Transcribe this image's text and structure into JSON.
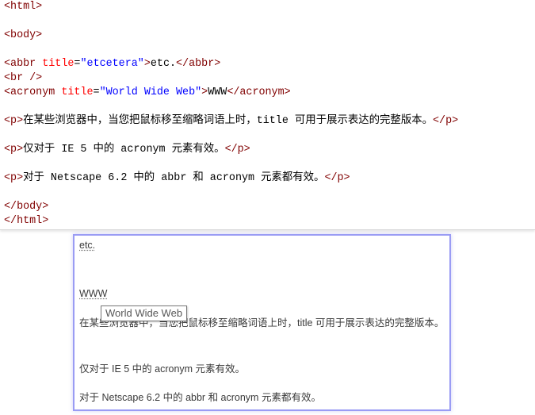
{
  "colors": {
    "tag": "#800000",
    "attr": "#ff0000",
    "value": "#0000ff",
    "text": "#000000"
  },
  "editor": {
    "lines": [
      [
        {
          "t": "<html>",
          "k": "tag"
        }
      ],
      [],
      [
        {
          "t": "<body>",
          "k": "tag"
        }
      ],
      [],
      [
        {
          "t": "<abbr",
          "k": "tag"
        },
        {
          "t": " ",
          "k": "text"
        },
        {
          "t": "title",
          "k": "attr"
        },
        {
          "t": "=",
          "k": "text"
        },
        {
          "t": "\"etcetera\"",
          "k": "value"
        },
        {
          "t": ">",
          "k": "tag"
        },
        {
          "t": "etc.",
          "k": "text"
        },
        {
          "t": "</abbr>",
          "k": "tag"
        }
      ],
      [
        {
          "t": "<br />",
          "k": "tag"
        }
      ],
      [
        {
          "t": "<acronym",
          "k": "tag"
        },
        {
          "t": " ",
          "k": "text"
        },
        {
          "t": "title",
          "k": "attr"
        },
        {
          "t": "=",
          "k": "text"
        },
        {
          "t": "\"World Wide Web\"",
          "k": "value"
        },
        {
          "t": ">",
          "k": "tag"
        },
        {
          "t": "WWW",
          "k": "text"
        },
        {
          "t": "</acronym>",
          "k": "tag"
        }
      ],
      [],
      [
        {
          "t": "<p>",
          "k": "tag"
        },
        {
          "t": "在某些浏览器中，当您把鼠标移至缩略词语上时，title 可用于展示表达的完整版本。",
          "k": "text"
        },
        {
          "t": "</p>",
          "k": "tag"
        }
      ],
      [],
      [
        {
          "t": "<p>",
          "k": "tag"
        },
        {
          "t": "仅对于 IE 5 中的 acronym 元素有效。",
          "k": "text"
        },
        {
          "t": "</p>",
          "k": "tag"
        }
      ],
      [],
      [
        {
          "t": "<p>",
          "k": "tag"
        },
        {
          "t": "对于 Netscape 6.2 中的 abbr 和 acronym 元素都有效。",
          "k": "text"
        },
        {
          "t": "</p>",
          "k": "tag"
        }
      ],
      [],
      [
        {
          "t": "</body>",
          "k": "tag"
        }
      ],
      [
        {
          "t": "</html>",
          "k": "tag"
        }
      ]
    ]
  },
  "result": {
    "abbr_text": "etc.",
    "acronym_text": "WWW",
    "para1": "在某些浏览器中，当您把鼠标移至缩略词语上时，title 可用于展示表达的完整版本。",
    "para2": "仅对于 IE 5 中的 acronym 元素有效。",
    "para3": "对于 Netscape 6.2 中的 abbr 和 acronym 元素都有效。"
  },
  "tooltip": {
    "text": "World Wide Web"
  }
}
